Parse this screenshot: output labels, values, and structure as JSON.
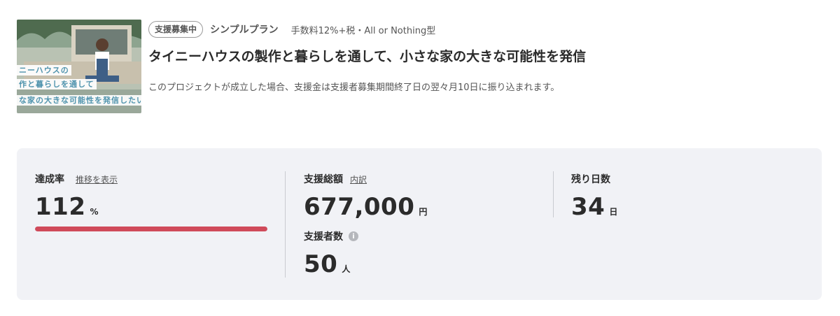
{
  "thumbnail": {
    "caption_lines": [
      "ニーハウスの",
      "作と暮らしを通して",
      "な家の大きな可能性を発信したい"
    ]
  },
  "header": {
    "status_badge": "支援募集中",
    "plan_name": "シンプルプラン",
    "fee_text": "手数料12%+税・All or Nothing型",
    "title": "タイニーハウスの製作と暮らしを通して、小さな家の大きな可能性を発信",
    "note": "このプロジェクトが成立した場合、支援金は支援者募集期間終了日の翌々月10日に振り込まれます。"
  },
  "stats": {
    "achievement": {
      "label": "達成率",
      "link": "推移を表示",
      "value": "112",
      "unit": "%",
      "progress_fraction": 1.0
    },
    "total": {
      "label": "支援総額",
      "link": "内訳",
      "value": "677,000",
      "unit": "円"
    },
    "backers": {
      "label": "支援者数",
      "icon": "info-icon",
      "value": "50",
      "unit": "人"
    },
    "days_left": {
      "label": "残り日数",
      "value": "34",
      "unit": "日"
    }
  },
  "colors": {
    "progress": "#d04a5a",
    "panel": "#f1f2f6",
    "caption": "#4f93ad"
  }
}
